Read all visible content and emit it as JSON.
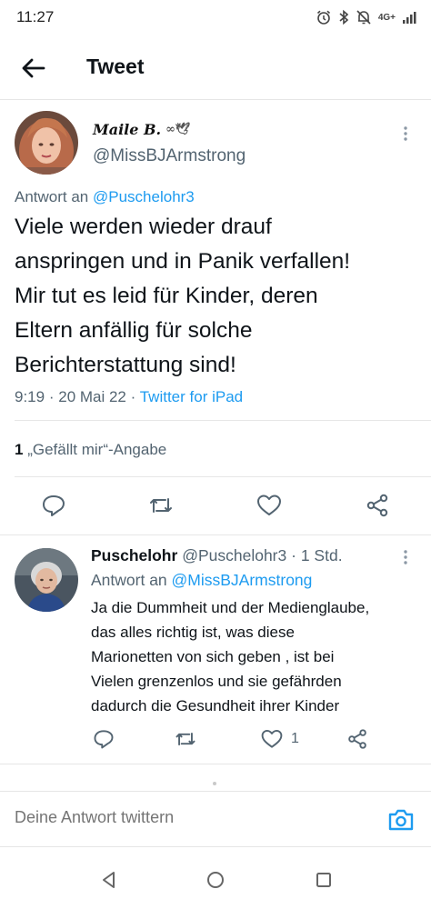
{
  "status_bar": {
    "time": "11:27",
    "network": "4G+",
    "icons": [
      "alarm-icon",
      "bluetooth-icon",
      "mute-icon",
      "signal-icon"
    ]
  },
  "header": {
    "title": "Tweet",
    "back_icon": "arrow-left-icon"
  },
  "main_tweet": {
    "display_name": "Maile B.",
    "display_name_emoji": "∞🕊",
    "handle": "@MissBJArmstrong",
    "reply_prefix": "Antwort an",
    "reply_to": "@Puschelohr3",
    "text_lines": [
      "Viele werden wieder drauf",
      "anspringen und in Panik verfallen!",
      "Mir tut es leid für Kinder, deren",
      "Eltern anfällig für solche",
      "Berichterstattung sind!"
    ],
    "time": "9:19",
    "date": "20 Mai 22",
    "sep": "·",
    "source": "Twitter for iPad",
    "likes_count": "1",
    "likes_label": "„Gefällt mir“-Angabe"
  },
  "reply_tweet": {
    "display_name": "Puschelohr",
    "handle": "@Puschelohr3",
    "sep": "·",
    "age": "1 Std.",
    "reply_prefix": "Antwort an",
    "reply_to": "@MissBJArmstrong",
    "text_lines": [
      "Ja die Dummheit und der Medienglaube,",
      "das alles richtig ist,  was diese",
      "Marionetten von sich geben , ist bei",
      "Vielen grenzenlos und sie gefährden",
      "dadurch die Gesundheit ihrer Kinder"
    ],
    "like_count": "1"
  },
  "compose": {
    "placeholder": "Deine Antwort twittern"
  },
  "colors": {
    "accent": "#1d9bf0",
    "text": "#0f1419",
    "secondary": "#536471",
    "divider": "#e6e6e6"
  }
}
